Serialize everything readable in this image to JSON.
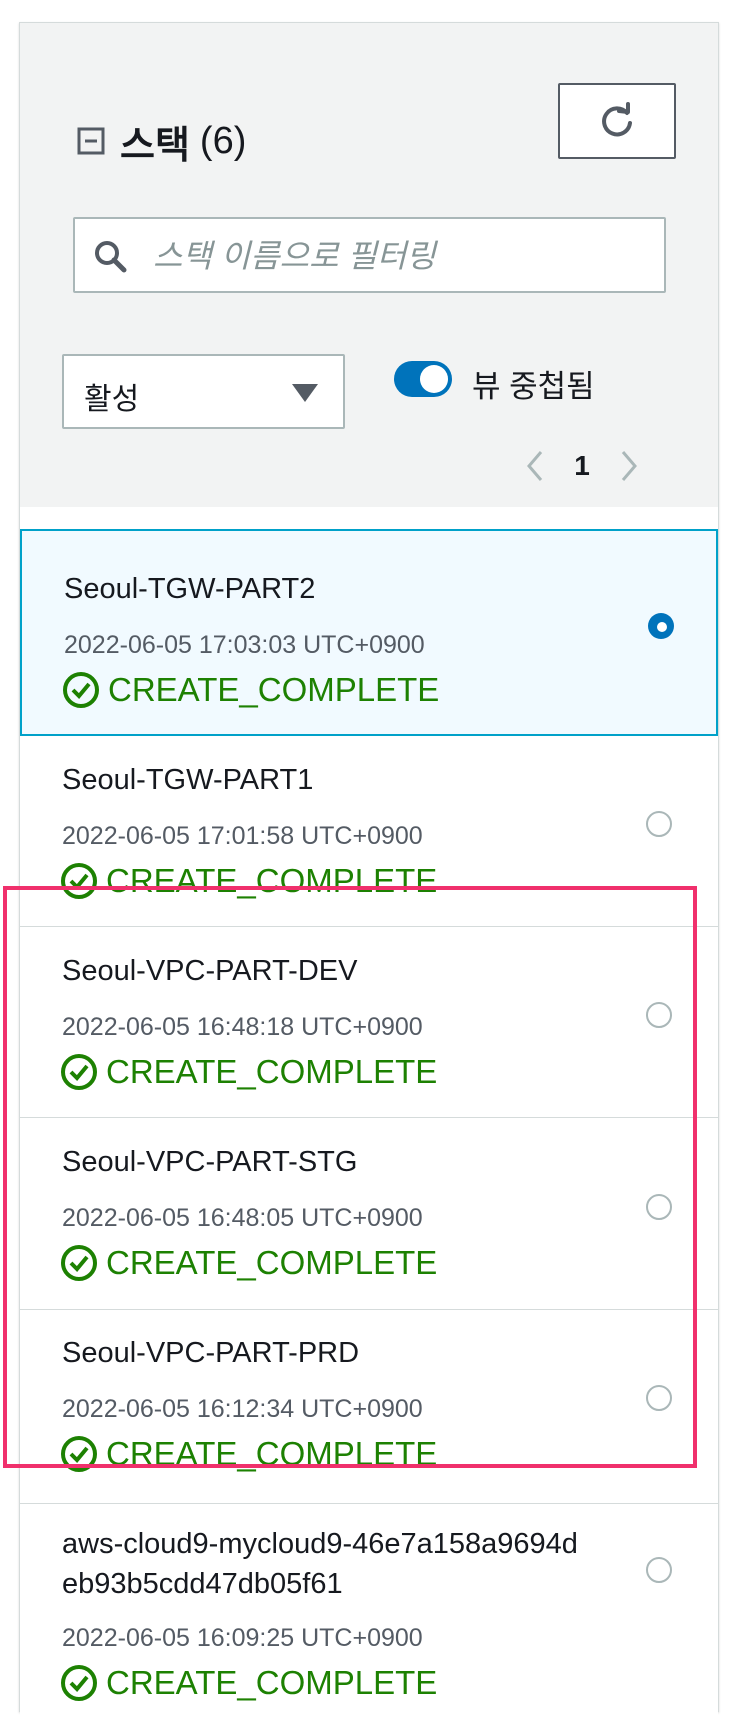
{
  "header": {
    "title": "스택",
    "count": "(6)"
  },
  "search": {
    "placeholder": "스택 이름으로 필터링"
  },
  "filter": {
    "selected": "활성"
  },
  "toggle": {
    "label": "뷰 중첩됨",
    "on": true
  },
  "pagination": {
    "current_page": "1"
  },
  "stacks": [
    {
      "name": "Seoul-TGW-PART2",
      "time": "2022-06-05 17:03:03 UTC+0900",
      "status": "CREATE_COMPLETE",
      "selected": true
    },
    {
      "name": "Seoul-TGW-PART1",
      "time": "2022-06-05 17:01:58 UTC+0900",
      "status": "CREATE_COMPLETE",
      "selected": false
    },
    {
      "name": "Seoul-VPC-PART-DEV",
      "time": "2022-06-05 16:48:18 UTC+0900",
      "status": "CREATE_COMPLETE",
      "selected": false
    },
    {
      "name": "Seoul-VPC-PART-STG",
      "time": "2022-06-05 16:48:05 UTC+0900",
      "status": "CREATE_COMPLETE",
      "selected": false
    },
    {
      "name": "Seoul-VPC-PART-PRD",
      "time": "2022-06-05 16:12:34 UTC+0900",
      "status": "CREATE_COMPLETE",
      "selected": false
    },
    {
      "name_line1": "aws-cloud9-mycloud9-46e7a158a9694d",
      "name_line2": "eb93b5cdd47db05f61",
      "time": "2022-06-05 16:09:25 UTC+0900",
      "status": "CREATE_COMPLETE",
      "selected": false
    }
  ],
  "colors": {
    "accent": "#0073bb",
    "success": "#1d8102",
    "highlight": "#f0306c",
    "selected_bg": "#f1faff"
  }
}
